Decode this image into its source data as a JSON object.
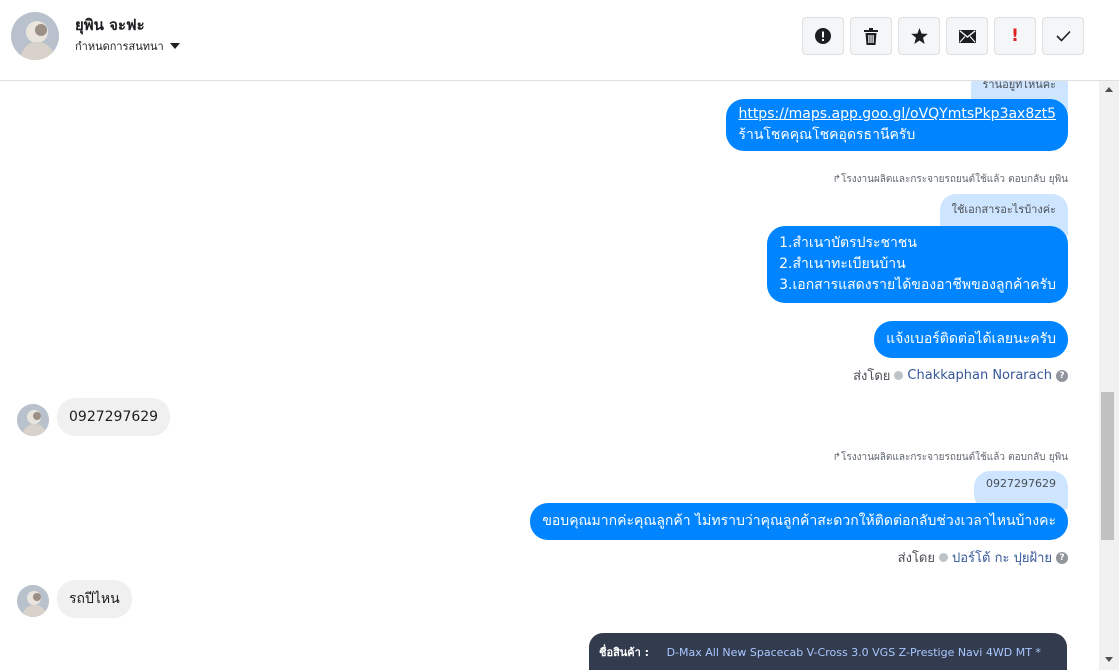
{
  "header": {
    "contact_name": "ยุพิน จะฟะ",
    "assign_label": "กำหนดการสนทนา",
    "toolbar": [
      {
        "icon": "alert-circle-icon"
      },
      {
        "icon": "trash-icon"
      },
      {
        "icon": "star-icon"
      },
      {
        "icon": "envelope-icon"
      },
      {
        "icon": "exclamation-icon",
        "text": "!"
      },
      {
        "icon": "check-icon"
      }
    ]
  },
  "messages": {
    "quote_top": "ร้านอยู่ที่ไหนคะ",
    "link_url": "https://maps.app.goo.gl/oVQYmtsPkp3ax8zt5",
    "shop_line": "ร้านโชคคุณโชคอุดรธานีครับ",
    "reply_meta_1": "โรงงานผลิตและกระจายรถยนต์ใช้แล้ว ตอบกลับ ยุพิน",
    "quote_docs": "ใช้เอกสารอะไรบ้างค่ะ",
    "docs_line1": "1.สำเนาบัตรประชาชน",
    "docs_line2": "2.สำเนาทะเบียนบ้าน",
    "docs_line3": "3.เอกสารแสดงรายได้ของอาชีพของลูกค้าครับ",
    "ask_number": "แจ้งเบอร์ติดต่อได้เลยนะครับ",
    "sent_by_label": "ส่งโดย",
    "agent_1": "Chakkaphan Norarach",
    "help_glyph": "?",
    "customer_phone": "0927297629",
    "reply_meta_2": "โรงงานผลิตและกระจายรถยนต์ใช้แล้ว ตอบกลับ ยุพิน",
    "quote_phone": "0927297629",
    "thanks_msg": "ขอบคุณมากค่ะคุณลูกค้า ไม่ทราบว่าคุณลูกค้าสะดวกให้ติดต่อกลับช่วงเวลาไหนบ้างคะ",
    "agent_2": "ปอร์โต้ กะ ปุยฝ้าย",
    "customer_question": "รถปีไหน",
    "product_label": "ชื่อสินค้า :",
    "product_value": "D-Max All New Spacecab V-Cross 3.0 VGS Z-Prestige Navi 4WD MT *"
  },
  "colors": {
    "outgoing_bubble": "#0084ff",
    "quote_bubble": "#cde5fe",
    "incoming_bubble": "#f0f0f0",
    "product_card": "#333c4e"
  }
}
